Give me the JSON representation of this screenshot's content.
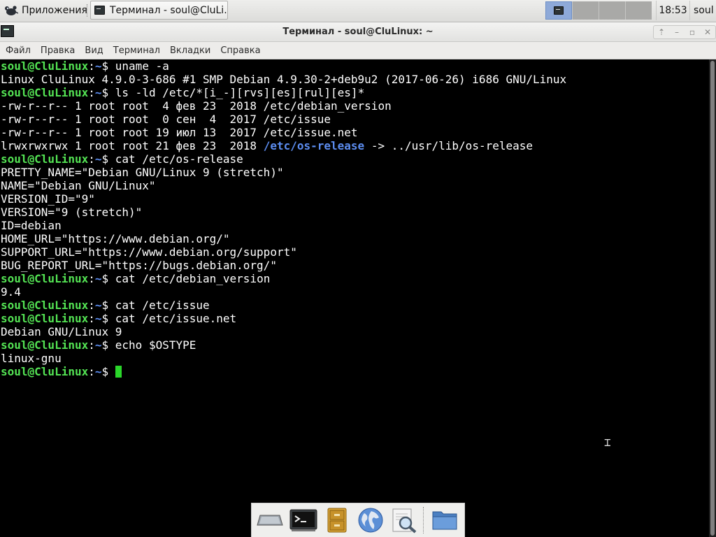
{
  "top_panel": {
    "apps_label": "Приложения",
    "task_label": "Терминал - soul@CluLi...",
    "clock": "18:53",
    "user": "soul"
  },
  "window": {
    "title": "Терминал - soul@CluLinux: ~",
    "controls": [
      "⇡",
      "–",
      "▫",
      "✕"
    ]
  },
  "menubar": {
    "items": [
      "Файл",
      "Правка",
      "Вид",
      "Терминал",
      "Вкладки",
      "Справка"
    ]
  },
  "terminal": {
    "prompt_user": "soul@CluLinux",
    "prompt_path": "~",
    "lines": [
      {
        "type": "prompt",
        "cmd": "uname -a"
      },
      {
        "type": "out",
        "text": "Linux CluLinux 4.9.0-3-686 #1 SMP Debian 4.9.30-2+deb9u2 (2017-06-26) i686 GNU/Linux"
      },
      {
        "type": "prompt",
        "cmd": "ls -ld /etc/*[i_-][rvs][es][rul][es]*"
      },
      {
        "type": "out",
        "text": "-rw-r--r-- 1 root root  4 фев 23  2018 /etc/debian_version"
      },
      {
        "type": "out",
        "text": "-rw-r--r-- 1 root root  0 сен  4  2017 /etc/issue"
      },
      {
        "type": "out",
        "text": "-rw-r--r-- 1 root root 19 июл 13  2017 /etc/issue.net"
      },
      {
        "type": "link",
        "text": "lrwxrwxrwx 1 root root 21 фев 23  2018 ",
        "link": "/etc/os-release",
        "rest": " -> ../usr/lib/os-release"
      },
      {
        "type": "prompt",
        "cmd": "cat /etc/os-release"
      },
      {
        "type": "out",
        "text": "PRETTY_NAME=\"Debian GNU/Linux 9 (stretch)\""
      },
      {
        "type": "out",
        "text": "NAME=\"Debian GNU/Linux\""
      },
      {
        "type": "out",
        "text": "VERSION_ID=\"9\""
      },
      {
        "type": "out",
        "text": "VERSION=\"9 (stretch)\""
      },
      {
        "type": "out",
        "text": "ID=debian"
      },
      {
        "type": "out",
        "text": "HOME_URL=\"https://www.debian.org/\""
      },
      {
        "type": "out",
        "text": "SUPPORT_URL=\"https://www.debian.org/support\""
      },
      {
        "type": "out",
        "text": "BUG_REPORT_URL=\"https://bugs.debian.org/\""
      },
      {
        "type": "prompt",
        "cmd": "cat /etc/debian_version"
      },
      {
        "type": "out",
        "text": "9.4"
      },
      {
        "type": "prompt",
        "cmd": "cat /etc/issue"
      },
      {
        "type": "prompt",
        "cmd": "cat /etc/issue.net"
      },
      {
        "type": "out",
        "text": "Debian GNU/Linux 9"
      },
      {
        "type": "prompt",
        "cmd": "echo $OSTYPE"
      },
      {
        "type": "out",
        "text": "linux-gnu"
      },
      {
        "type": "prompt",
        "cmd": "",
        "cursor": true
      }
    ]
  },
  "dock": {
    "items": [
      {
        "name": "show-desktop-icon"
      },
      {
        "name": "terminal-icon"
      },
      {
        "name": "file-cabinet-icon"
      },
      {
        "name": "web-browser-globe-icon"
      },
      {
        "name": "search-magnifier-icon"
      },
      {
        "name": "folder-icon"
      }
    ]
  },
  "colors": {
    "prompt_user": "#54e454",
    "prompt_path": "#5c8df0",
    "cursor": "#2ad62a"
  }
}
